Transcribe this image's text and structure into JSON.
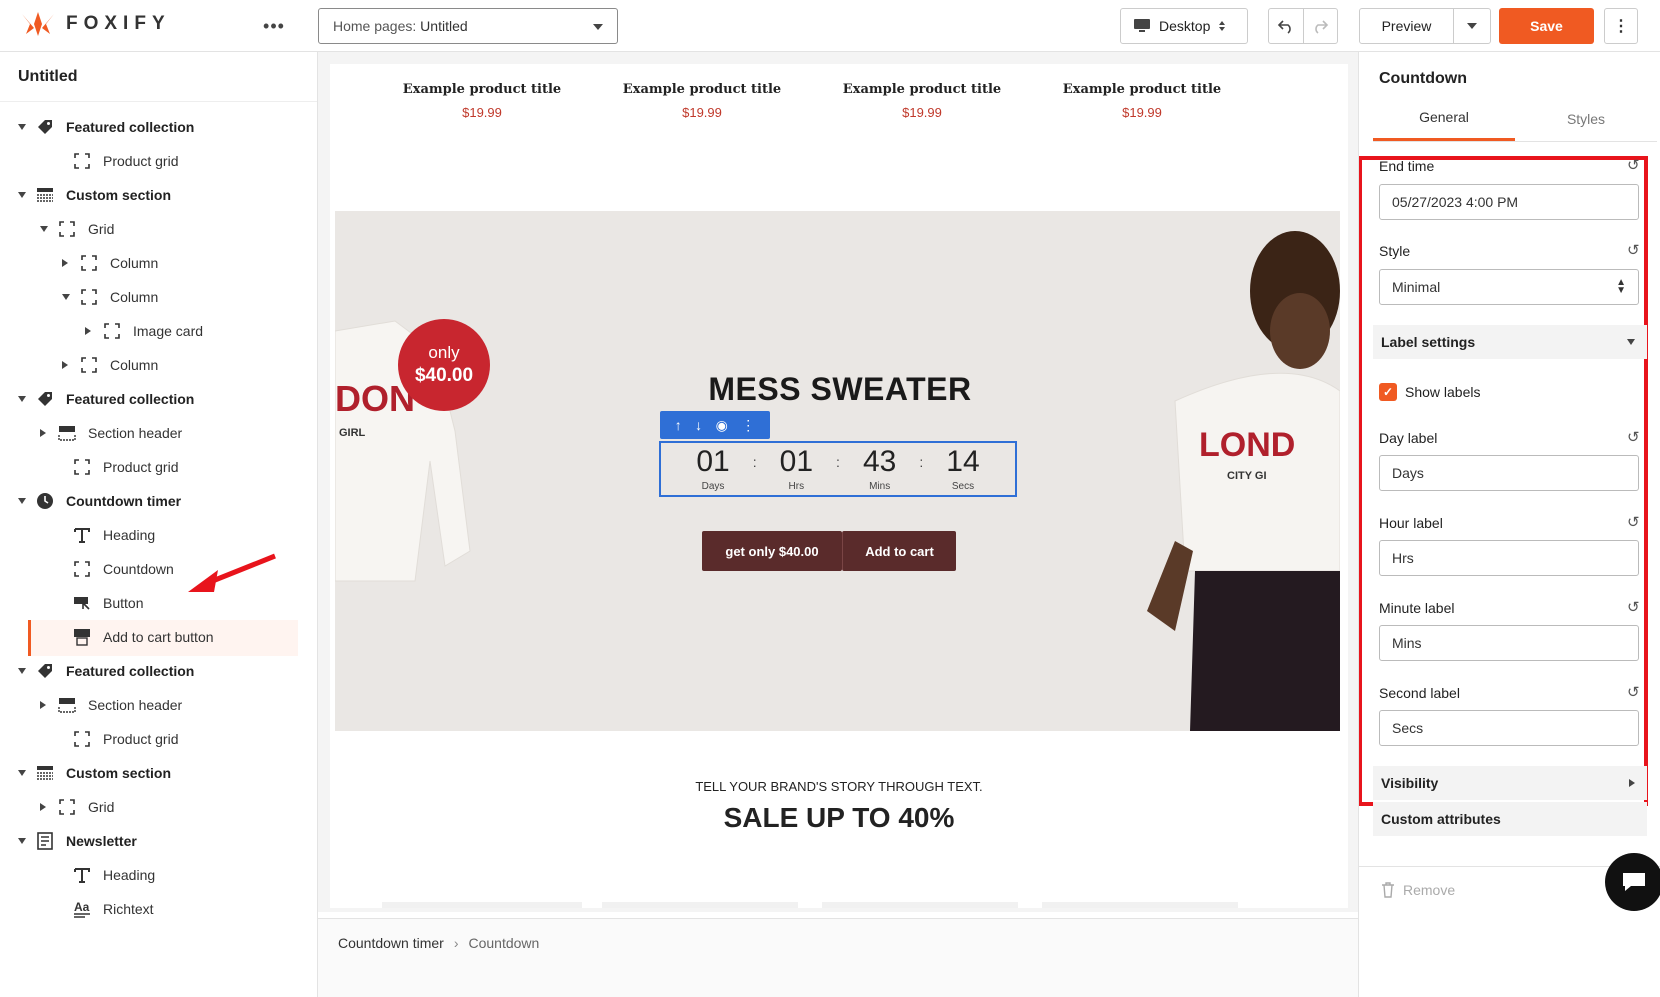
{
  "app": {
    "logo_text": "FOXIFY",
    "page_selector": {
      "prefix": "Home pages:",
      "value": "Untitled"
    },
    "device": "Desktop",
    "preview_label": "Preview",
    "save_label": "Save",
    "accent_color": "#f05a22"
  },
  "left": {
    "title": "Untitled",
    "tree": [
      {
        "label": "Featured collection",
        "icon": "tag-icon"
      },
      {
        "label": "Product grid",
        "icon": "frame-icon"
      },
      {
        "label": "Custom section",
        "icon": "section-icon"
      },
      {
        "label": "Grid",
        "icon": "frame-icon"
      },
      {
        "label": "Column",
        "icon": "frame-icon"
      },
      {
        "label": "Column",
        "icon": "frame-icon"
      },
      {
        "label": "Image card",
        "icon": "frame-icon"
      },
      {
        "label": "Column",
        "icon": "frame-icon"
      },
      {
        "label": "Featured collection",
        "icon": "tag-icon"
      },
      {
        "label": "Section header",
        "icon": "section-header-icon"
      },
      {
        "label": "Product grid",
        "icon": "frame-icon"
      },
      {
        "label": "Countdown timer",
        "icon": "clock-icon"
      },
      {
        "label": "Heading",
        "icon": "text-icon"
      },
      {
        "label": "Countdown",
        "icon": "frame-icon"
      },
      {
        "label": "Button",
        "icon": "button-icon"
      },
      {
        "label": "Add to cart button",
        "icon": "cart-button-icon"
      },
      {
        "label": "Featured collection",
        "icon": "tag-icon"
      },
      {
        "label": "Section header",
        "icon": "section-header-icon"
      },
      {
        "label": "Product grid",
        "icon": "frame-icon"
      },
      {
        "label": "Custom section",
        "icon": "section-icon"
      },
      {
        "label": "Grid",
        "icon": "frame-icon"
      },
      {
        "label": "Newsletter",
        "icon": "newsletter-icon"
      },
      {
        "label": "Heading",
        "icon": "text-icon"
      },
      {
        "label": "Richtext",
        "icon": "richtext-icon"
      }
    ]
  },
  "canvas": {
    "products": [
      {
        "title": "Example product title",
        "price": "$19.99"
      },
      {
        "title": "Example product title",
        "price": "$19.99"
      },
      {
        "title": "Example product title",
        "price": "$19.99"
      },
      {
        "title": "Example product title",
        "price": "$19.99"
      }
    ],
    "badge": {
      "line1": "only",
      "line2": "$40.00"
    },
    "banner_title": "MESS SWEATER",
    "countdown": [
      {
        "value": "01",
        "label": "Days"
      },
      {
        "value": "01",
        "label": "Hrs"
      },
      {
        "value": "43",
        "label": "Mins"
      },
      {
        "value": "14",
        "label": "Secs"
      }
    ],
    "button_primary": "get only $40.00",
    "button_cart": "Add to cart",
    "story": "TELL YOUR BRAND'S STORY THROUGH TEXT.",
    "sale": "SALE UP TO 40%"
  },
  "breadcrumb": {
    "parent": "Countdown timer",
    "current": "Countdown"
  },
  "right": {
    "title": "Countdown",
    "tabs": [
      "General",
      "Styles"
    ],
    "end_time_label": "End time",
    "end_time_value": "05/27/2023 4:00 PM",
    "style_label": "Style",
    "style_value": "Minimal",
    "label_settings": "Label settings",
    "show_labels": "Show labels",
    "day_label": "Day label",
    "day_value": "Days",
    "hour_label": "Hour label",
    "hour_value": "Hrs",
    "minute_label": "Minute label",
    "minute_value": "Mins",
    "second_label": "Second label",
    "second_value": "Secs",
    "visibility": "Visibility",
    "custom_attributes": "Custom attributes",
    "remove": "Remove"
  }
}
